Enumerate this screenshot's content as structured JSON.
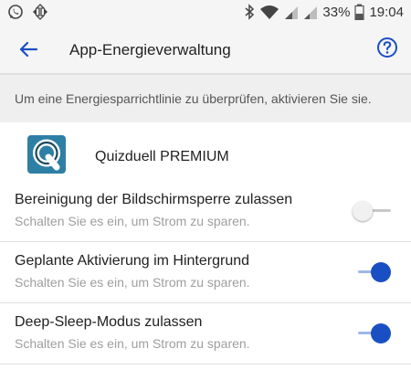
{
  "status_bar": {
    "battery": "33%",
    "time": "19:04",
    "icons": [
      "whatsapp-icon",
      "screen-rotate-icon",
      "bluetooth-icon",
      "wifi-icon",
      "signal-icon",
      "signal-icon",
      "battery-icon"
    ]
  },
  "header": {
    "title": "App-Energieverwaltung",
    "back_icon": "arrow-left-icon",
    "help_icon": "help-circle-icon"
  },
  "banner": {
    "text": "Um eine Energiesparrichtlinie zu überprüfen, aktivieren Sie sie."
  },
  "app": {
    "name": "Quizduell PREMIUM",
    "icon_letter": "Q"
  },
  "settings": [
    {
      "title": "Bereinigung der Bildschirmsperre zulassen",
      "subtitle": "Schalten Sie es ein, um Strom zu sparen.",
      "enabled": false
    },
    {
      "title": "Geplante Aktivierung im Hintergrund",
      "subtitle": "Schalten Sie es ein, um Strom zu sparen.",
      "enabled": true
    },
    {
      "title": "Deep-Sleep-Modus zulassen",
      "subtitle": "Schalten Sie es ein, um Strom zu sparen.",
      "enabled": true
    }
  ],
  "colors": {
    "accent": "#1a4fc4",
    "accent_track": "#9db8e8",
    "app_icon_bg": "#2e7fa6"
  }
}
